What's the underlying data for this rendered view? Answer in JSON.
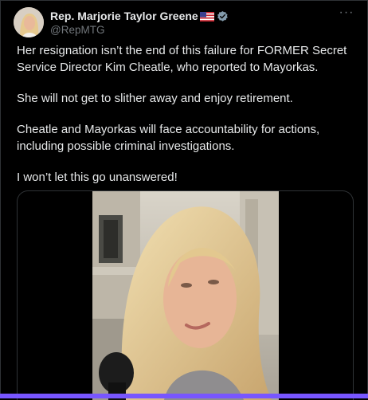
{
  "author": {
    "display_name": "Rep. Marjorie Taylor Greene",
    "handle": "@RepMTG",
    "flag": "us-flag-icon",
    "verified_badge": "verified-badge-icon"
  },
  "more_label": "···",
  "paragraphs": [
    "Her resignation isn’t the end of this failure for FORMER Secret Service Director Kim Cheatle, who reported to Mayorkas.",
    "She will not get to slither away and enjoy retirement.",
    "Cheatle and Mayorkas will face accountability for actions, including possible criminal investigations.",
    "I won’t let this go unanswered!"
  ],
  "media": {
    "type": "video",
    "subject": "woman speaking into microphone outside building"
  },
  "colors": {
    "background": "#000000",
    "text": "#e7e9ea",
    "muted": "#71767b",
    "border": "#2f3336",
    "accent_bar": "#7856ff",
    "verified": "#829aab"
  }
}
